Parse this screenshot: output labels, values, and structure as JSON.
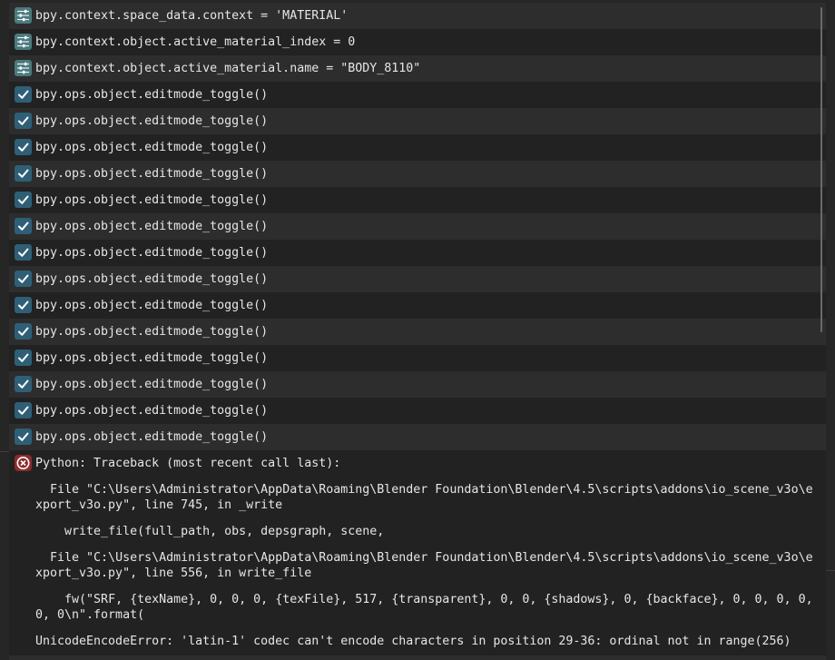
{
  "colors": {
    "panel_bg": "#262626",
    "row_odd": "#2d2d2d",
    "row_even": "#222222",
    "text": "#e6e6e6",
    "property_icon": "#4a7a7e",
    "operator_icon": "#2f5f76",
    "error_icon": "#8c2b2b"
  },
  "log_rows": [
    {
      "kind": "property",
      "icon": "sliders-icon",
      "text": "bpy.context.space_data.context = 'MATERIAL'"
    },
    {
      "kind": "property",
      "icon": "sliders-icon",
      "text": "bpy.context.object.active_material_index = 0"
    },
    {
      "kind": "property",
      "icon": "sliders-icon",
      "text": "bpy.context.object.active_material.name = \"BODY_8110\""
    },
    {
      "kind": "operator",
      "icon": "checkmark-icon",
      "text": "bpy.ops.object.editmode_toggle()"
    },
    {
      "kind": "operator",
      "icon": "checkmark-icon",
      "text": "bpy.ops.object.editmode_toggle()"
    },
    {
      "kind": "operator",
      "icon": "checkmark-icon",
      "text": "bpy.ops.object.editmode_toggle()"
    },
    {
      "kind": "operator",
      "icon": "checkmark-icon",
      "text": "bpy.ops.object.editmode_toggle()"
    },
    {
      "kind": "operator",
      "icon": "checkmark-icon",
      "text": "bpy.ops.object.editmode_toggle()"
    },
    {
      "kind": "operator",
      "icon": "checkmark-icon",
      "text": "bpy.ops.object.editmode_toggle()"
    },
    {
      "kind": "operator",
      "icon": "checkmark-icon",
      "text": "bpy.ops.object.editmode_toggle()"
    },
    {
      "kind": "operator",
      "icon": "checkmark-icon",
      "text": "bpy.ops.object.editmode_toggle()"
    },
    {
      "kind": "operator",
      "icon": "checkmark-icon",
      "text": "bpy.ops.object.editmode_toggle()"
    },
    {
      "kind": "operator",
      "icon": "checkmark-icon",
      "text": "bpy.ops.object.editmode_toggle()"
    },
    {
      "kind": "operator",
      "icon": "checkmark-icon",
      "text": "bpy.ops.object.editmode_toggle()"
    },
    {
      "kind": "operator",
      "icon": "checkmark-icon",
      "text": "bpy.ops.object.editmode_toggle()"
    },
    {
      "kind": "operator",
      "icon": "checkmark-icon",
      "text": "bpy.ops.object.editmode_toggle()"
    },
    {
      "kind": "operator",
      "icon": "checkmark-icon",
      "text": "bpy.ops.object.editmode_toggle()"
    }
  ],
  "error": {
    "icon": "error-x-icon",
    "header": "Python: Traceback (most recent call last):",
    "lines": [
      "  File \"C:\\Users\\Administrator\\AppData\\Roaming\\Blender Foundation\\Blender\\4.5\\scripts\\addons\\io_scene_v3o\\export_v3o.py\", line 745, in _write",
      "    write_file(full_path, obs, depsgraph, scene,",
      "  File \"C:\\Users\\Administrator\\AppData\\Roaming\\Blender Foundation\\Blender\\4.5\\scripts\\addons\\io_scene_v3o\\export_v3o.py\", line 556, in write_file",
      "    fw(\"SRF, {texName}, 0, 0, 0, {texFile}, 517, {transparent}, 0, 0, {shadows}, 0, {backface}, 0, 0, 0, 0, 0, 0\\n\".format(",
      "UnicodeEncodeError: 'latin-1' codec can't encode characters in position 29-36: ordinal not in range(256)"
    ]
  }
}
